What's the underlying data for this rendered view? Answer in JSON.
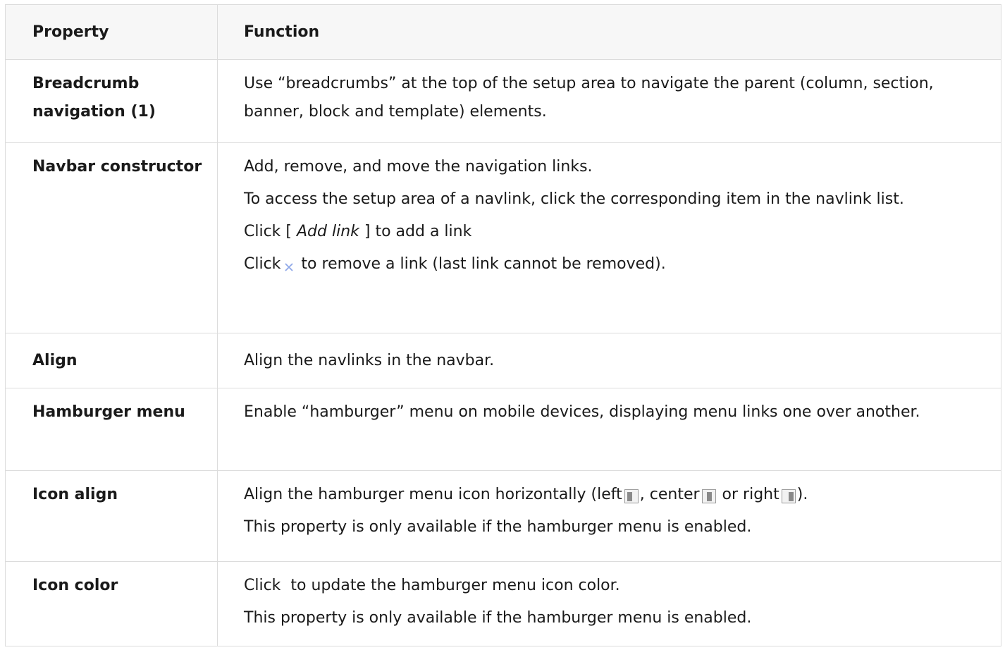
{
  "table": {
    "headers": {
      "property": "Property",
      "function": "Function"
    },
    "rows": {
      "breadcrumb": {
        "property": "Breadcrumb navigation (1)",
        "function": "Use “breadcrumbs” at the top of the setup area to navigate the parent (column, section, banner, block and template) elements."
      },
      "navbar": {
        "property": "Navbar constructor",
        "p1": "Add, remove, and move the navigation links.",
        "p2": "To access the setup area of a navlink, click the corresponding item in the navlink list.",
        "p3_before": "Click [ ",
        "p3_em": "Add link",
        "p3_after": " ] to add a link",
        "p4_before": "Click",
        "p4_after": "to remove a link (last link cannot be removed)."
      },
      "align": {
        "property": "Align",
        "function": "Align the navlinks in the navbar."
      },
      "hamburger": {
        "property": "Hamburger menu",
        "function": "Enable “hamburger” menu on mobile devices, displaying menu links one over another."
      },
      "icon_align": {
        "property": "Icon align",
        "p1_a": "Align the hamburger menu icon horizontally (left",
        "p1_b": ", center",
        "p1_c": "or right",
        "p1_d": ").",
        "p2": "This property is only available if the hamburger menu is enabled."
      },
      "icon_color": {
        "property": "Icon color",
        "p1_before": "Click",
        "p1_after": "to update the hamburger menu icon color.",
        "p2": "This property is only available if the hamburger menu is enabled."
      }
    }
  },
  "icons": {
    "remove": "close-x-icon",
    "align_left": "align-left-icon",
    "align_center": "align-center-icon",
    "align_right": "align-right-icon",
    "color": "color-picker-icon"
  },
  "colors": {
    "remove_icon": "#8fa8e8",
    "header_bg": "#f7f7f7",
    "border": "#dcdcdc"
  }
}
